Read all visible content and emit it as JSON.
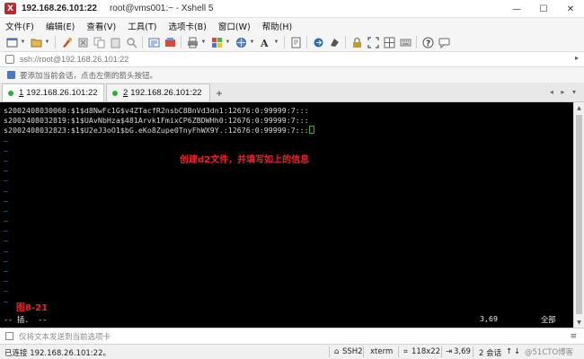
{
  "titlebar": {
    "icon_letter": "X",
    "host": "192.168.26.101:22",
    "rest": "root@vms001:~ - Xshell 5",
    "minimize": "—",
    "maximize": "☐",
    "close": "✕"
  },
  "menu": [
    "文件(F)",
    "编辑(E)",
    "查看(V)",
    "工具(T)",
    "选项卡(B)",
    "窗口(W)",
    "帮助(H)"
  ],
  "address": {
    "value": "ssh://root@192.168.26.101:22",
    "arrow": "▸"
  },
  "hint": "要添加当前会话，点击左侧的箭头按钮。",
  "tabs": [
    {
      "number": "1",
      "label": "192.168.26.101:22",
      "active": true
    },
    {
      "number": "2",
      "label": "192.168.26.101:22",
      "active": false
    }
  ],
  "tab_add": "+",
  "tab_nav": "◂ ▸ ▾",
  "terminal": {
    "lines": [
      "s2002408030068:$1$d8NwFc1G$v4ZTacfR2nsbC8BnVd3dn1:12676:0:99999:7:::",
      "s2002408032819:$1$UAvNbHza$481Arvk1FmixCP6ZBDWHh0:12676:0:99999:7:::",
      "s2002408032823:$1$U2eJ3oO1$bG.eKo8Zupe0TnyFhWX9Y.:12676:0:99999:7:::"
    ],
    "tilde": "~",
    "annotation": "创建d2文件，并填写如上的信息",
    "figure_label": "图8-21",
    "vim_mode": "-- 插.  --",
    "vim_position": "3,69",
    "vim_scope": "全部"
  },
  "sendbar": {
    "placeholder": "仅将文本发送到当前选项卡",
    "menu_icon": "≡"
  },
  "status": {
    "connection": "已连接 192.168.26.101:22。",
    "protocol": "SSH2",
    "terminal_type": "xterm",
    "size": "118x22",
    "cursor": "3,69",
    "sessions": "2 会话",
    "nav_up": "↑",
    "nav_down": "↓"
  },
  "watermark": "@51CTO博客",
  "colors": {
    "annotation": "#e8262a",
    "tilde": "#3a78c8",
    "cursor": "#2fae2f",
    "terminal_bg": "#000000"
  }
}
